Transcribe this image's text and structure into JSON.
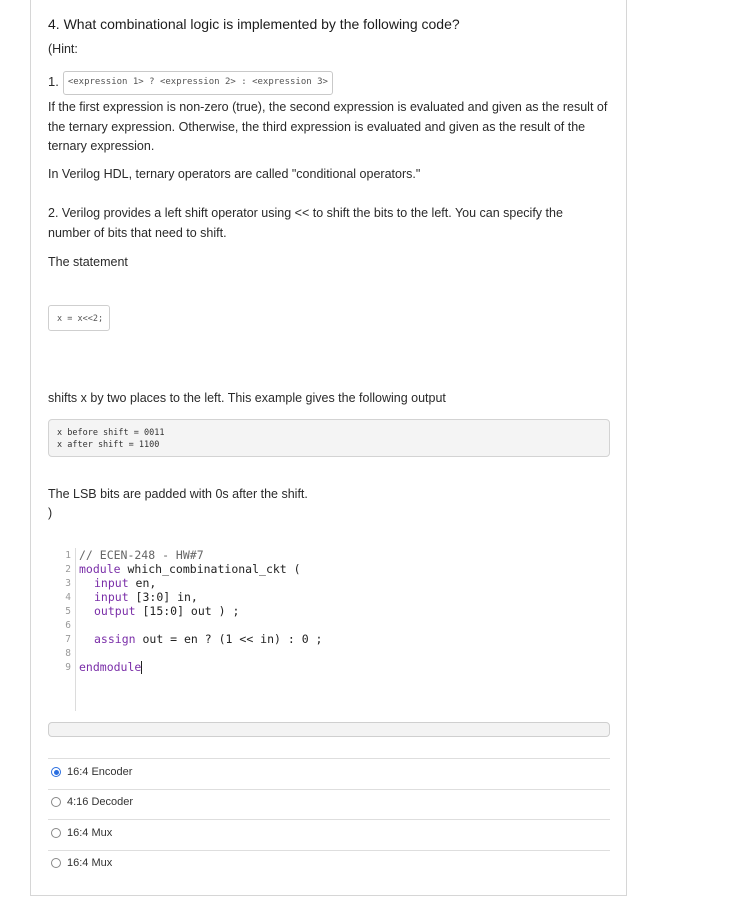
{
  "question": {
    "title": "4. What combinational logic is implemented by the following code?",
    "hint_open": "(Hint:",
    "item1_prefix": "1.",
    "item1_code": "<expression 1> ? <expression 2> : <expression 3>",
    "item1_line1": "If the first expression is non-zero (true), the second expression is evaluated and given as the result of",
    "item1_line2": "the ternary expression. Otherwise, the third expression is evaluated and given as the result of the",
    "item1_line3": "ternary expression.",
    "item1_note": "In Verilog HDL, ternary operators are called \"conditional operators.\"",
    "item2_line1": "2. Verilog provides a left shift operator using << to shift the bits to the left. You can specify the",
    "item2_line2": "number of bits that need to shift.",
    "statement": "The statement",
    "shift_code": "x = x<<2;",
    "shift_desc": "shifts x by two places to the left. This example gives the following output",
    "output_line1": "x before shift = 0011",
    "output_line2": "x after shift = 1100",
    "lsb_note": "The LSB bits are padded with 0s after the shift.",
    "hint_close": ")"
  },
  "code": {
    "line_numbers": [
      "1",
      "2",
      "3",
      "4",
      "5",
      "6",
      "7",
      "8",
      "9"
    ],
    "l1": "// ECEN-248 - HW#7",
    "l2_kw": "module",
    "l2_rest": " which_combinational_ckt (",
    "l3_kw": "input",
    "l3_rest": " en,",
    "l4_kw": "input",
    "l4_rest": " [3:0] in,",
    "l5_kw": "output",
    "l5_rest": " [15:0] out ) ;",
    "l7_kw": "assign",
    "l7_rest": " out = en ? (1 << in) : 0 ;",
    "l9_kw": "endmodule"
  },
  "options": [
    {
      "label": "16:4 Encoder",
      "selected": true
    },
    {
      "label": "4:16 Decoder",
      "selected": false
    },
    {
      "label": "16:4 Mux",
      "selected": false
    },
    {
      "label": "16:4 Mux",
      "selected": false
    }
  ],
  "colors": {
    "accent": "#2a6ee0"
  }
}
